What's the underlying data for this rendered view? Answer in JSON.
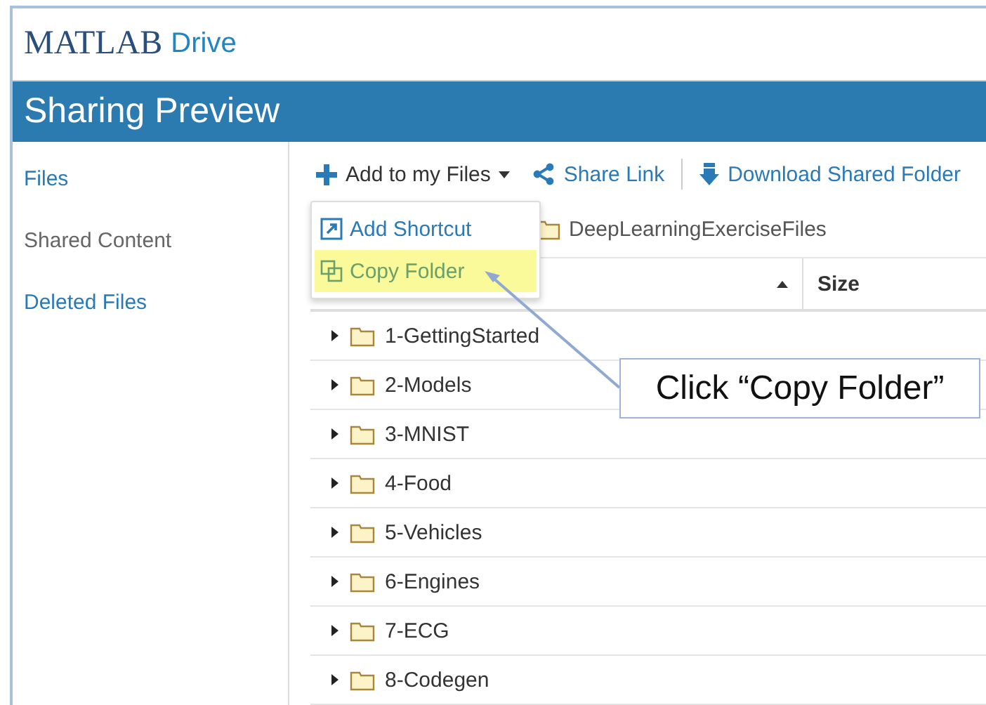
{
  "header": {
    "logo": "MATLAB",
    "product": "Drive"
  },
  "title_bar": {
    "title": "Sharing Preview"
  },
  "sidebar": {
    "items": [
      {
        "label": "Files",
        "selected": false
      },
      {
        "label": "Shared Content",
        "selected": true
      },
      {
        "label": "Deleted Files",
        "selected": false
      }
    ]
  },
  "toolbar": {
    "buttons": [
      {
        "kind": "add",
        "label": "Add to my Files"
      },
      {
        "kind": "share",
        "label": "Share Link"
      },
      {
        "kind": "download",
        "label": "Download Shared Folder"
      }
    ]
  },
  "menu": {
    "items": [
      {
        "kind": "shortcut",
        "label": "Add Shortcut",
        "selected": false
      },
      {
        "kind": "copy",
        "label": "Copy Folder",
        "selected": true
      }
    ]
  },
  "breadcrumb": {
    "folder": "DeepLearningExerciseFiles"
  },
  "table": {
    "columns": [
      {
        "label": "Size"
      }
    ],
    "rows": [
      {
        "name": "1-GettingStarted"
      },
      {
        "name": "2-Models"
      },
      {
        "name": "3-MNIST"
      },
      {
        "name": "4-Food"
      },
      {
        "name": "5-Vehicles"
      },
      {
        "name": "6-Engines"
      },
      {
        "name": "7-ECG"
      },
      {
        "name": "8-Codegen"
      }
    ]
  },
  "callout": {
    "text": "Click “Copy Folder”"
  }
}
